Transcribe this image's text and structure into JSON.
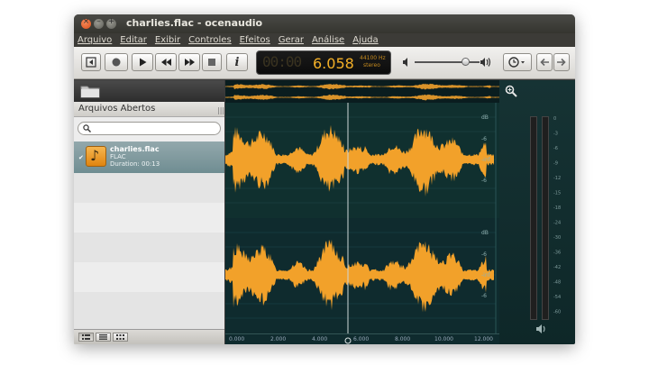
{
  "window": {
    "title": "charlies.flac - ocenaudio",
    "buttons": {
      "close": "×",
      "minimize": "–",
      "maximize": "+"
    }
  },
  "menu": [
    "Arquivo",
    "Editar",
    "Exibir",
    "Controles",
    "Efeitos",
    "Gerar",
    "Análise",
    "Ajuda"
  ],
  "toolbar": {
    "icons": [
      "back-to-start-icon",
      "record-icon",
      "play-icon",
      "rewind-icon",
      "fast-forward-icon",
      "stop-icon",
      "info-icon",
      "volume-low-icon",
      "volume-high-icon",
      "clock-icon",
      "undo-icon",
      "redo-icon"
    ],
    "info_label": "i"
  },
  "lcd": {
    "time": "6.058",
    "ghost_digits": "00:00",
    "sample_rate": "44100 Hz",
    "mode": "stereo"
  },
  "left_panel": {
    "header": "Arquivos Abertos",
    "search_placeholder": "",
    "file": {
      "name": "charlies.flac",
      "format": "FLAC",
      "duration": "Duration: 00:13"
    }
  },
  "waveform": {
    "db_labels": [
      "dB",
      "-6",
      "-inf",
      "-6"
    ],
    "ruler": [
      "0.000",
      "2.000",
      "4.000",
      "6.000",
      "8.000",
      "10.000",
      "12.000"
    ],
    "colors": {
      "wave": "#f2a12a",
      "background": "#0f2b2e",
      "grid": "#1f4a4d"
    }
  },
  "meters": {
    "scale": [
      "0",
      "-3",
      "-6",
      "-9",
      "-12",
      "-15",
      "-18",
      "-24",
      "-30",
      "-36",
      "-42",
      "-48",
      "-54",
      "-60"
    ]
  }
}
